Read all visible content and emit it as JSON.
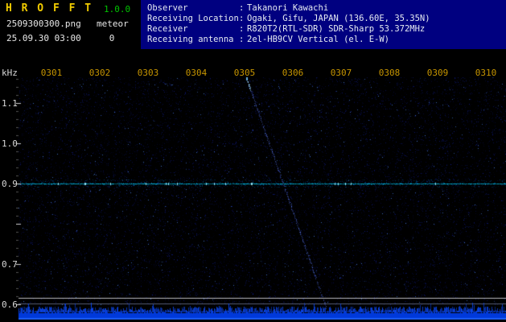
{
  "app": {
    "title": "H R O F F T",
    "version": "1.0.0",
    "filename": "2509300300.png",
    "mode": "meteor",
    "datetime": "25.09.30 03:00",
    "count": "0"
  },
  "info": {
    "separator": ":",
    "rows": [
      {
        "label": "Observer",
        "value": "Takanori Kawachi"
      },
      {
        "label": "Receiving Location",
        "value": "Ogaki, Gifu, JAPAN (136.60E, 35.35N)"
      },
      {
        "label": "Receiver",
        "value": "R820T2(RTL-SDR) SDR-Sharp 53.372MHz"
      },
      {
        "label": "Receiving antenna",
        "value": "2el-HB9CV Vertical (el. E-W)"
      }
    ]
  },
  "chart_data": {
    "type": "heatmap",
    "subtype": "radio meteor-echo spectrogram (HROFFT)",
    "x_ticks": [
      "0301",
      "0302",
      "0303",
      "0304",
      "0305",
      "0306",
      "0307",
      "0308",
      "0309",
      "0310"
    ],
    "x_axis_note": "time of day hhmm, one-minute spacing, 10-minute window starting 25.09.30 03:00",
    "ylabel": "kHz",
    "y_ticks": [
      "1.1",
      "1.0",
      "0.9",
      "0.7",
      "0.6"
    ],
    "y_tick_values_khz": [
      1.1,
      1.0,
      0.9,
      0.7,
      0.6
    ],
    "ylim_khz": [
      0.58,
      1.17
    ],
    "legend": "none",
    "grid": "off",
    "features": {
      "carrier_line_khz": 0.9,
      "carrier_line_note": "continuous bright cyan direct-carrier line across full width",
      "doppler_echo_trace": {
        "start_min": 5.05,
        "start_khz": 1.16,
        "end_min": 6.7,
        "end_khz": 0.59,
        "note": "faint dotted blue trace descending from ~03:05 at 1.16 kHz to ~03:06.7 at 0.59 kHz"
      },
      "separator_lines_khz": [
        0.616,
        0.602
      ],
      "noise_floor_band": "dense blue signal-level strip with jagged top along bottom edge",
      "background_noise": "sparse dim blue speckle over black"
    }
  },
  "colors": {
    "background": "#000000",
    "header_panel_bg": "#000080",
    "title_yellow": "#f2cc00",
    "version_green": "#00c400",
    "time_label_gold": "#c89600",
    "axis_text": "#d8d8d8",
    "header_text": "#e6ebf2",
    "carrier_cyan": "#00d7ff",
    "noise_blue": "#1e32ff",
    "echo_blue": "#5a78ff"
  }
}
